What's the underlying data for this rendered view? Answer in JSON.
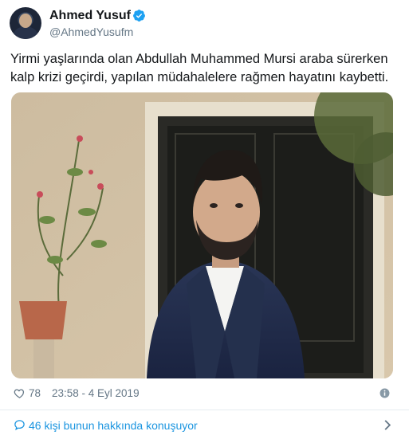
{
  "author": {
    "name": "Ahmed Yusuf",
    "handle": "@AhmedYusufm",
    "verified_icon": "verified-badge-icon"
  },
  "tweet": {
    "text": "Yirmi yaşlarında olan Abdullah Muhammed Mursi araba sürerken kalp krizi geçirdi, yapılan müdahalelere rağmen hayatını kaybetti."
  },
  "meta": {
    "likes": "78",
    "timestamp": "23:58 - 4 Eyl 2019",
    "like_icon": "heart-icon",
    "info_icon": "info-icon"
  },
  "footer": {
    "conversation": "46 kişi bunun hakkında konuşuyor",
    "icon": "speech-bubble-icon",
    "chevron": "chevron-right-icon"
  },
  "colors": {
    "accent": "#1b95e0",
    "muted": "#657786",
    "verified": "#1da1f2"
  }
}
